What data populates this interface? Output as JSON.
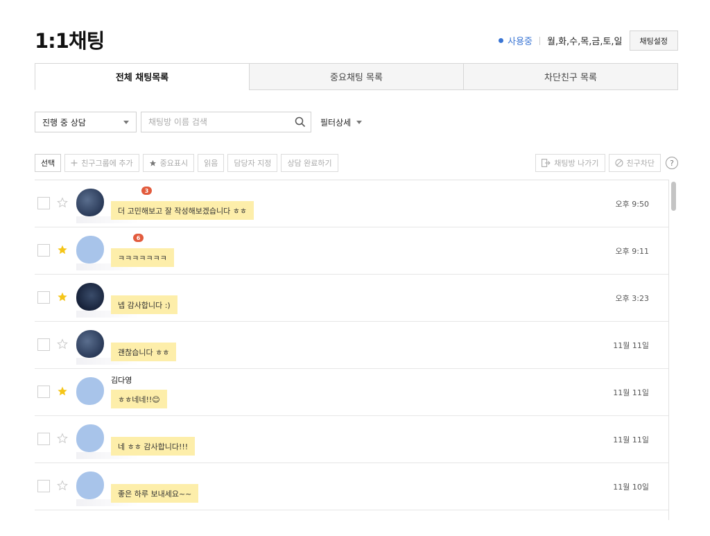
{
  "header": {
    "title": "1:1채팅",
    "status_label": "사용중",
    "status_color": "#3a75d4",
    "days": "월,화,수,목,금,토,일",
    "settings_label": "채팅설정"
  },
  "tabs": [
    {
      "label": "전체 채팅목록",
      "active": true
    },
    {
      "label": "중요채팅 목록",
      "active": false
    },
    {
      "label": "차단친구 목록",
      "active": false
    }
  ],
  "filters": {
    "status_select": "진행 중 상담",
    "search_placeholder": "채팅방 이름 검색",
    "search_icon": "search-icon",
    "detail_label": "필터상세"
  },
  "toolbar": {
    "select": "선택",
    "add_group": "친구그룹에 추가",
    "mark_important": "중요표시",
    "read": "읽음",
    "assign": "담당자 지정",
    "complete": "상담 완료하기",
    "leave": "채팅방 나가기",
    "block": "친구차단",
    "help": "?"
  },
  "chats": [
    {
      "message": "더 고민해보고 잘 작성해보겠습니다 ㅎㅎ",
      "time": "오후 9:50",
      "starred": false,
      "unread": "3",
      "name": ""
    },
    {
      "message": "ㅋㅋㅋㅋㅋㅋㅋ",
      "time": "오후 9:11",
      "starred": true,
      "unread": "6",
      "name": ""
    },
    {
      "message": "넵 감사합니다 :)",
      "time": "오후 3:23",
      "starred": true,
      "unread": "",
      "name": ""
    },
    {
      "message": "괜찮습니다 ㅎㅎ",
      "time": "11월 11일",
      "starred": false,
      "unread": "",
      "name": ""
    },
    {
      "message": "ㅎㅎ네네!!😊",
      "time": "11월 11일",
      "starred": true,
      "unread": "",
      "name": "김다영"
    },
    {
      "message": "네 ㅎㅎ 감사합니다!!!",
      "time": "11월 11일",
      "starred": false,
      "unread": "",
      "name": ""
    },
    {
      "message": "좋은 하루 보내세요~~",
      "time": "11월 10일",
      "starred": false,
      "unread": "",
      "name": ""
    }
  ],
  "colors": {
    "bubble": "#fdeeaa",
    "badge": "#e25b3d",
    "star_on": "#f5c518",
    "star_off": "#c9c9c9"
  }
}
